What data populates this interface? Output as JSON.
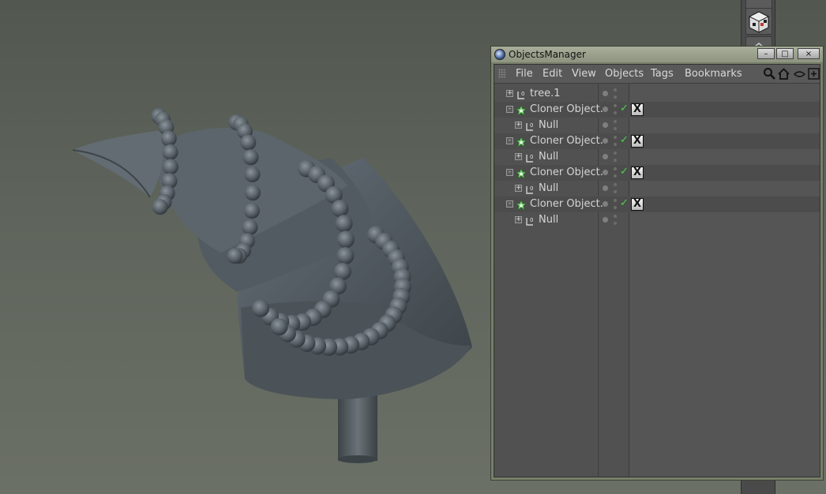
{
  "window": {
    "title": "ObjectsManager",
    "buttons": {
      "minimize": "–",
      "maximize": "□",
      "close": "×"
    }
  },
  "menu": [
    {
      "key": "file",
      "label": "File"
    },
    {
      "key": "edit",
      "label": "Edit"
    },
    {
      "key": "view",
      "label": "View"
    },
    {
      "key": "objects",
      "label": "Objects"
    },
    {
      "key": "tags",
      "label": "Tags"
    },
    {
      "key": "bookmarks",
      "label": "Bookmarks"
    }
  ],
  "toolbar_icons": [
    "search-icon",
    "home-icon",
    "view-toggle-icon",
    "new-manager-icon"
  ],
  "objects": [
    {
      "label": "tree.1",
      "type": "null",
      "level": 0,
      "expander": "+",
      "tag": false
    },
    {
      "label": "Cloner Object.",
      "type": "cloner",
      "level": 0,
      "expander": "-",
      "tag": true,
      "enabled_check": "✓"
    },
    {
      "label": "Null",
      "type": "null",
      "level": 1,
      "expander": "+",
      "tag": false
    },
    {
      "label": "Cloner Object.",
      "type": "cloner",
      "level": 0,
      "expander": "-",
      "tag": true,
      "enabled_check": "✓"
    },
    {
      "label": "Null",
      "type": "null",
      "level": 1,
      "expander": "+",
      "tag": false
    },
    {
      "label": "Cloner Object.",
      "type": "cloner",
      "level": 0,
      "expander": "-",
      "tag": true,
      "enabled_check": "✓"
    },
    {
      "label": "Null",
      "type": "null",
      "level": 1,
      "expander": "+",
      "tag": false
    },
    {
      "label": "Cloner Object.",
      "type": "cloner",
      "level": 0,
      "expander": "-",
      "tag": true,
      "enabled_check": "✓"
    },
    {
      "label": "Null",
      "type": "null",
      "level": 1,
      "expander": "+",
      "tag": false
    }
  ],
  "tag_symbol": "X",
  "colors": {
    "viewport_bg": "#5f655c",
    "model": "#525b60",
    "check": "#52d04a",
    "window_frame": "#777f6a"
  },
  "palette_icons": [
    "texture-cube-icon",
    "polygon-object-icon"
  ]
}
